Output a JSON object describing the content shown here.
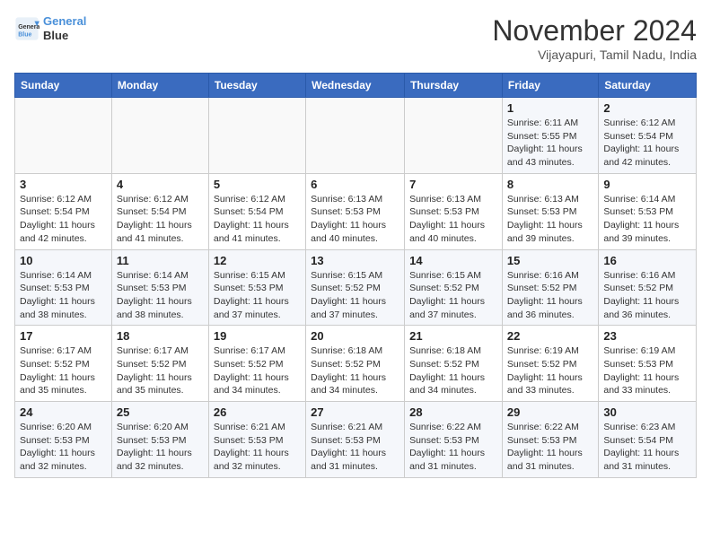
{
  "header": {
    "logo_line1": "General",
    "logo_line2": "Blue",
    "month_title": "November 2024",
    "location": "Vijayapuri, Tamil Nadu, India"
  },
  "weekdays": [
    "Sunday",
    "Monday",
    "Tuesday",
    "Wednesday",
    "Thursday",
    "Friday",
    "Saturday"
  ],
  "weeks": [
    [
      {
        "day": "",
        "info": ""
      },
      {
        "day": "",
        "info": ""
      },
      {
        "day": "",
        "info": ""
      },
      {
        "day": "",
        "info": ""
      },
      {
        "day": "",
        "info": ""
      },
      {
        "day": "1",
        "info": "Sunrise: 6:11 AM\nSunset: 5:55 PM\nDaylight: 11 hours and 43 minutes."
      },
      {
        "day": "2",
        "info": "Sunrise: 6:12 AM\nSunset: 5:54 PM\nDaylight: 11 hours and 42 minutes."
      }
    ],
    [
      {
        "day": "3",
        "info": "Sunrise: 6:12 AM\nSunset: 5:54 PM\nDaylight: 11 hours and 42 minutes."
      },
      {
        "day": "4",
        "info": "Sunrise: 6:12 AM\nSunset: 5:54 PM\nDaylight: 11 hours and 41 minutes."
      },
      {
        "day": "5",
        "info": "Sunrise: 6:12 AM\nSunset: 5:54 PM\nDaylight: 11 hours and 41 minutes."
      },
      {
        "day": "6",
        "info": "Sunrise: 6:13 AM\nSunset: 5:53 PM\nDaylight: 11 hours and 40 minutes."
      },
      {
        "day": "7",
        "info": "Sunrise: 6:13 AM\nSunset: 5:53 PM\nDaylight: 11 hours and 40 minutes."
      },
      {
        "day": "8",
        "info": "Sunrise: 6:13 AM\nSunset: 5:53 PM\nDaylight: 11 hours and 39 minutes."
      },
      {
        "day": "9",
        "info": "Sunrise: 6:14 AM\nSunset: 5:53 PM\nDaylight: 11 hours and 39 minutes."
      }
    ],
    [
      {
        "day": "10",
        "info": "Sunrise: 6:14 AM\nSunset: 5:53 PM\nDaylight: 11 hours and 38 minutes."
      },
      {
        "day": "11",
        "info": "Sunrise: 6:14 AM\nSunset: 5:53 PM\nDaylight: 11 hours and 38 minutes."
      },
      {
        "day": "12",
        "info": "Sunrise: 6:15 AM\nSunset: 5:53 PM\nDaylight: 11 hours and 37 minutes."
      },
      {
        "day": "13",
        "info": "Sunrise: 6:15 AM\nSunset: 5:52 PM\nDaylight: 11 hours and 37 minutes."
      },
      {
        "day": "14",
        "info": "Sunrise: 6:15 AM\nSunset: 5:52 PM\nDaylight: 11 hours and 37 minutes."
      },
      {
        "day": "15",
        "info": "Sunrise: 6:16 AM\nSunset: 5:52 PM\nDaylight: 11 hours and 36 minutes."
      },
      {
        "day": "16",
        "info": "Sunrise: 6:16 AM\nSunset: 5:52 PM\nDaylight: 11 hours and 36 minutes."
      }
    ],
    [
      {
        "day": "17",
        "info": "Sunrise: 6:17 AM\nSunset: 5:52 PM\nDaylight: 11 hours and 35 minutes."
      },
      {
        "day": "18",
        "info": "Sunrise: 6:17 AM\nSunset: 5:52 PM\nDaylight: 11 hours and 35 minutes."
      },
      {
        "day": "19",
        "info": "Sunrise: 6:17 AM\nSunset: 5:52 PM\nDaylight: 11 hours and 34 minutes."
      },
      {
        "day": "20",
        "info": "Sunrise: 6:18 AM\nSunset: 5:52 PM\nDaylight: 11 hours and 34 minutes."
      },
      {
        "day": "21",
        "info": "Sunrise: 6:18 AM\nSunset: 5:52 PM\nDaylight: 11 hours and 34 minutes."
      },
      {
        "day": "22",
        "info": "Sunrise: 6:19 AM\nSunset: 5:52 PM\nDaylight: 11 hours and 33 minutes."
      },
      {
        "day": "23",
        "info": "Sunrise: 6:19 AM\nSunset: 5:53 PM\nDaylight: 11 hours and 33 minutes."
      }
    ],
    [
      {
        "day": "24",
        "info": "Sunrise: 6:20 AM\nSunset: 5:53 PM\nDaylight: 11 hours and 32 minutes."
      },
      {
        "day": "25",
        "info": "Sunrise: 6:20 AM\nSunset: 5:53 PM\nDaylight: 11 hours and 32 minutes."
      },
      {
        "day": "26",
        "info": "Sunrise: 6:21 AM\nSunset: 5:53 PM\nDaylight: 11 hours and 32 minutes."
      },
      {
        "day": "27",
        "info": "Sunrise: 6:21 AM\nSunset: 5:53 PM\nDaylight: 11 hours and 31 minutes."
      },
      {
        "day": "28",
        "info": "Sunrise: 6:22 AM\nSunset: 5:53 PM\nDaylight: 11 hours and 31 minutes."
      },
      {
        "day": "29",
        "info": "Sunrise: 6:22 AM\nSunset: 5:53 PM\nDaylight: 11 hours and 31 minutes."
      },
      {
        "day": "30",
        "info": "Sunrise: 6:23 AM\nSunset: 5:54 PM\nDaylight: 11 hours and 31 minutes."
      }
    ]
  ]
}
